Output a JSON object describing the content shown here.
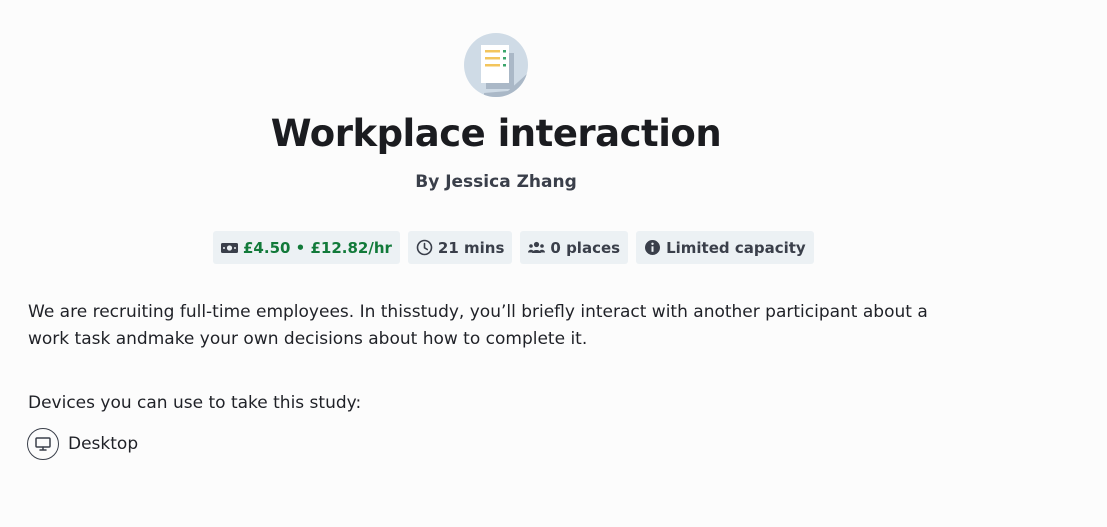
{
  "study": {
    "title": "Workplace interaction",
    "author": "By Jessica Zhang",
    "badges": {
      "reward": "£4.50 • £12.82/hr",
      "duration": "21 mins",
      "places": "0 places",
      "capacity": "Limited capacity"
    },
    "description": "We are recruiting full-time employees. In thisstudy, you’ll briefly interact with another participant about a work task andmake your own decisions about how to complete it.",
    "devices_label": "Devices you can use to take this study:",
    "devices": [
      {
        "label": "Desktop",
        "icon": "desktop-icon"
      }
    ]
  },
  "colors": {
    "reward": "#127a3a",
    "badge_bg": "#ecf1f4",
    "icon_bg": "#cfdbe6"
  }
}
